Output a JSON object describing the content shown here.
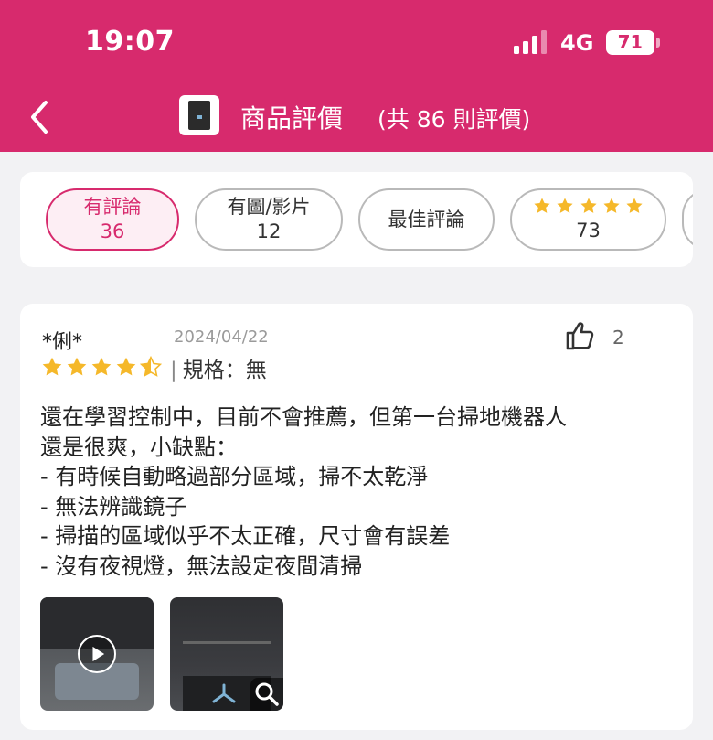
{
  "status_bar": {
    "time": "19:07",
    "network": "4G",
    "battery": "71"
  },
  "header": {
    "title": "商品評價",
    "review_count": "(共 86 則評價)"
  },
  "filters": [
    {
      "label": "有評論",
      "count": "36",
      "active": true
    },
    {
      "label": "有圖/影片",
      "count": "12",
      "active": false
    },
    {
      "label": "最佳評論",
      "active": false
    },
    {
      "label": "★★★★★",
      "count": "73",
      "active": false
    }
  ],
  "review": {
    "reviewer": "*俐*",
    "date": "2024/04/22",
    "likes": "2",
    "rating": 4.5,
    "spec": "規格：無",
    "text": "還在學習控制中，目前不會推薦，但第一台掃地機器人\n還是很爽，小缺點：\n- 有時候自動略過部分區域，掃不太乾淨\n- 無法辨識鏡子\n- 掃描的區域似乎不太正確，尺寸會有誤差\n- 沒有夜視燈，無法設定夜間清掃",
    "media": [
      {
        "kind": "video-thumbnail",
        "icon": "play-icon"
      },
      {
        "kind": "photo-thumbnail",
        "icon": "zoom-icon"
      }
    ]
  },
  "colors": {
    "brand": "#d72a6d",
    "star": "#f5b82a",
    "chip_border": "#b9b9b9"
  }
}
